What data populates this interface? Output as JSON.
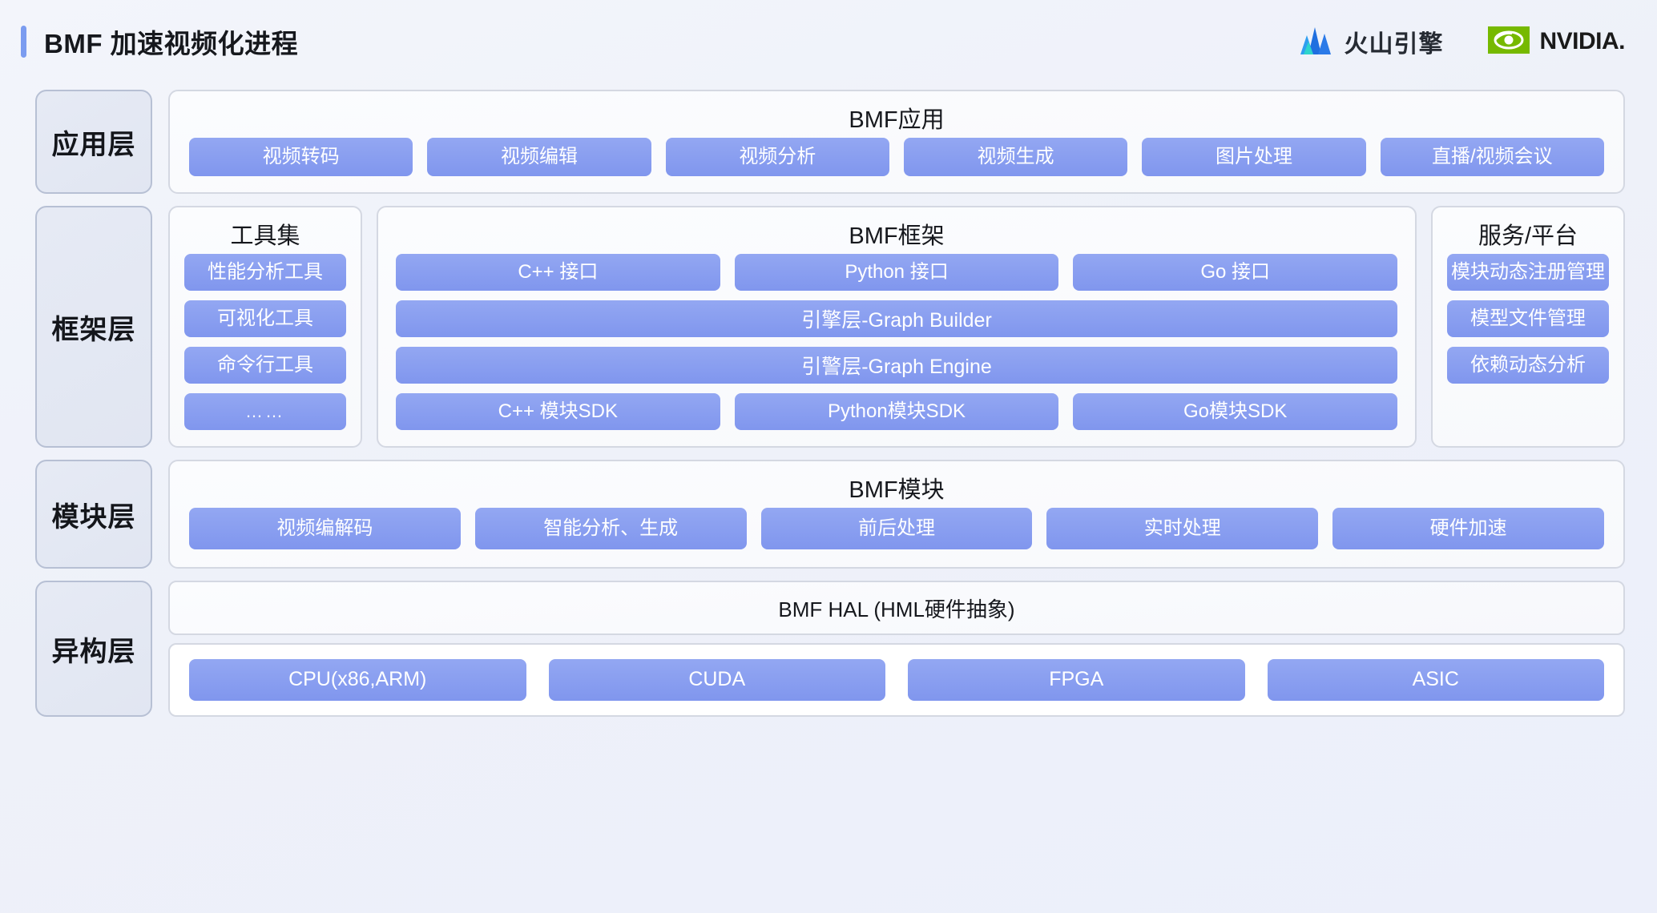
{
  "header": {
    "title": "BMF 加速视频化进程",
    "logos": [
      {
        "name": "volcano-engine",
        "text": "火山引擎"
      },
      {
        "name": "nvidia",
        "text": "NVIDIA."
      }
    ]
  },
  "layers": {
    "application": {
      "label": "应用层",
      "panel_title": "BMF应用",
      "items": [
        "视频转码",
        "视频编辑",
        "视频分析",
        "视频生成",
        "图片处理",
        "直播/视频会议"
      ]
    },
    "framework": {
      "label": "框架层",
      "tools": {
        "title": "工具集",
        "items": [
          "性能分析工具",
          "可视化工具",
          "命令行工具",
          "……"
        ]
      },
      "core": {
        "title": "BMF框架",
        "interfaces": [
          "C++ 接口",
          "Python 接口",
          "Go 接口"
        ],
        "engine_builder": "引擎层-Graph Builder",
        "engine_runtime": "引警层-Graph Engine",
        "sdks": [
          "C++ 模块SDK",
          "Python模块SDK",
          "Go模块SDK"
        ]
      },
      "services": {
        "title": "服务/平台",
        "items": [
          "模块动态注册管理",
          "模型文件管理",
          "依赖动态分析"
        ]
      }
    },
    "module": {
      "label": "模块层",
      "panel_title": "BMF模块",
      "items": [
        "视频编解码",
        "智能分析、生成",
        "前后处理",
        "实时处理",
        "硬件加速"
      ]
    },
    "hetero": {
      "label": "异构层",
      "hal_title": "BMF HAL (HML硬件抽象)",
      "items": [
        "CPU(x86,ARM)",
        "CUDA",
        "FPGA",
        "ASIC"
      ]
    }
  },
  "colors": {
    "accent": "#7b9cf0",
    "chip": "#8096ee",
    "chip_light": "#93a7f2",
    "layer_label_bg": "#e3e8f2",
    "panel_bg": "#fbfcfe",
    "page_bg": "#eff1f9",
    "nvidia_green": "#76b900"
  }
}
